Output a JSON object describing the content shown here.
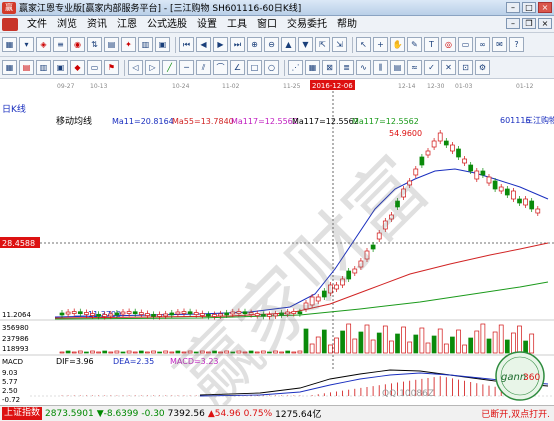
{
  "window": {
    "title": "赢家江恩专业版[赢家内部服务平台] - [三江购物  SH601116-60日K线]"
  },
  "menu": {
    "items": [
      "文件",
      "浏览",
      "资讯",
      "江恩",
      "公式选股",
      "设置",
      "工具",
      "窗口",
      "交易委托",
      "帮助"
    ]
  },
  "chart": {
    "period_label": "日K线",
    "stock_code": "601116",
    "stock_name": "三江购物",
    "ma_title": "移动均线",
    "ma11": "Ma11=20.8164",
    "ma55": "Ma55=13.7840",
    "ma117a": "Ma117=12.5562",
    "ma117b": "Ma117=12.5562",
    "ma117c": "Ma117=12.5562",
    "date_ticks": [
      "09-27",
      "10-13",
      "10-24",
      "11-02",
      "11-25",
      "12-14",
      "12-30",
      "01-03",
      "01-12"
    ],
    "highlight_date": "2016-12-06",
    "crosshair_price": "28.4588",
    "high_label": "54.9600",
    "low_label": "11.3700",
    "price_axis_low": "11.2064",
    "volume_ticks": [
      "356980",
      "237986",
      "118993"
    ],
    "macd_label": "MACD",
    "dif": "DIF=3.96",
    "dea": "DEA=2.35",
    "macd_val": "MACD=3.23",
    "macd_ticks": [
      "9.03",
      "5.77",
      "2.50",
      "-0.72"
    ],
    "watermark_qq": "QQ:10086Z"
  },
  "chart_data": {
    "type": "candlestick",
    "moving_averages": [
      "Ma11",
      "Ma55",
      "Ma117"
    ],
    "ma_colors": {
      "Ma11": "#1a2fbf",
      "Ma55": "#d12424",
      "Ma117": "#1b9a1b"
    },
    "high": 54.96,
    "low": 11.37,
    "volume_axis": [
      356980,
      237986,
      118993
    ],
    "macd": {
      "dif": 3.96,
      "dea": 2.35,
      "macd": 3.23
    },
    "macd_axis": [
      9.03,
      5.77,
      2.5,
      -0.72
    ]
  },
  "status": {
    "index_tag": "上证指数",
    "index_value": "2873.5901",
    "index_change": "▼-8.6399",
    "index_pct": "-0.30",
    "stock_value": "7392.56",
    "stock_change": "▲54.96",
    "stock_pct": "0.75%",
    "turnover": "1275.64亿",
    "notice": "已断开,双点打开."
  },
  "colors": {
    "up": "#d11111",
    "down": "#0a8a0a",
    "accent": "#1a2fbf"
  }
}
